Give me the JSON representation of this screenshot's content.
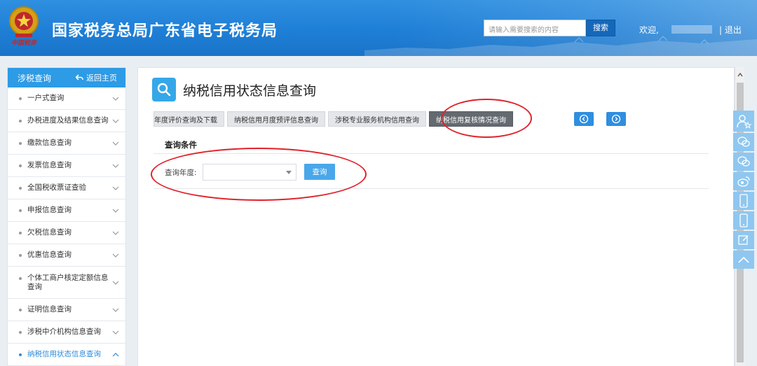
{
  "header": {
    "emblem_label": "中国税务",
    "site_title": "国家税务总局广东省电子税务局",
    "search_placeholder": "请输入需要搜索的内容",
    "search_button": "搜索",
    "welcome": "欢迎,",
    "logout": "| 退出"
  },
  "sidebar": {
    "title": "涉税查询",
    "back_home": "返回主页",
    "items": [
      {
        "label": "一户式查询"
      },
      {
        "label": "办税进度及结果信息查询"
      },
      {
        "label": "缴款信息查询"
      },
      {
        "label": "发票信息查询"
      },
      {
        "label": "全国税收票证查验"
      },
      {
        "label": "申报信息查询"
      },
      {
        "label": "欠税信息查询"
      },
      {
        "label": "优惠信息查询"
      },
      {
        "label": "个体工商户核定定额信息查询"
      },
      {
        "label": "证明信息查询"
      },
      {
        "label": "涉税中介机构信息查询"
      },
      {
        "label": "纳税信用状态信息查询"
      }
    ]
  },
  "main": {
    "page_title": "纳税信用状态信息查询",
    "tabs": [
      {
        "label": "年度评价查询及下载"
      },
      {
        "label": "纳税信用月度预评信息查询"
      },
      {
        "label": "涉税专业服务机构信用查询"
      },
      {
        "label": "纳税信用复核情况查询"
      }
    ],
    "section_title": "查询条件",
    "year_label": "查询年度:",
    "year_value": "",
    "query_button": "查询"
  },
  "colors": {
    "header_blue": "#1e7fd6",
    "sidebar_head": "#2d9be6",
    "active_tab": "#646a70",
    "query_button": "#49a7ea",
    "annotation_red": "#e0222a",
    "toolbar_blue": "#8fc7f0"
  },
  "icons": {
    "title_icon": "magnifier-icon",
    "toolbar": [
      "user-star-icon",
      "wechat-icon",
      "wechat-icon",
      "weibo-icon",
      "mobile-icon",
      "mobile-icon",
      "edit-icon",
      "chevron-up-icon"
    ]
  }
}
